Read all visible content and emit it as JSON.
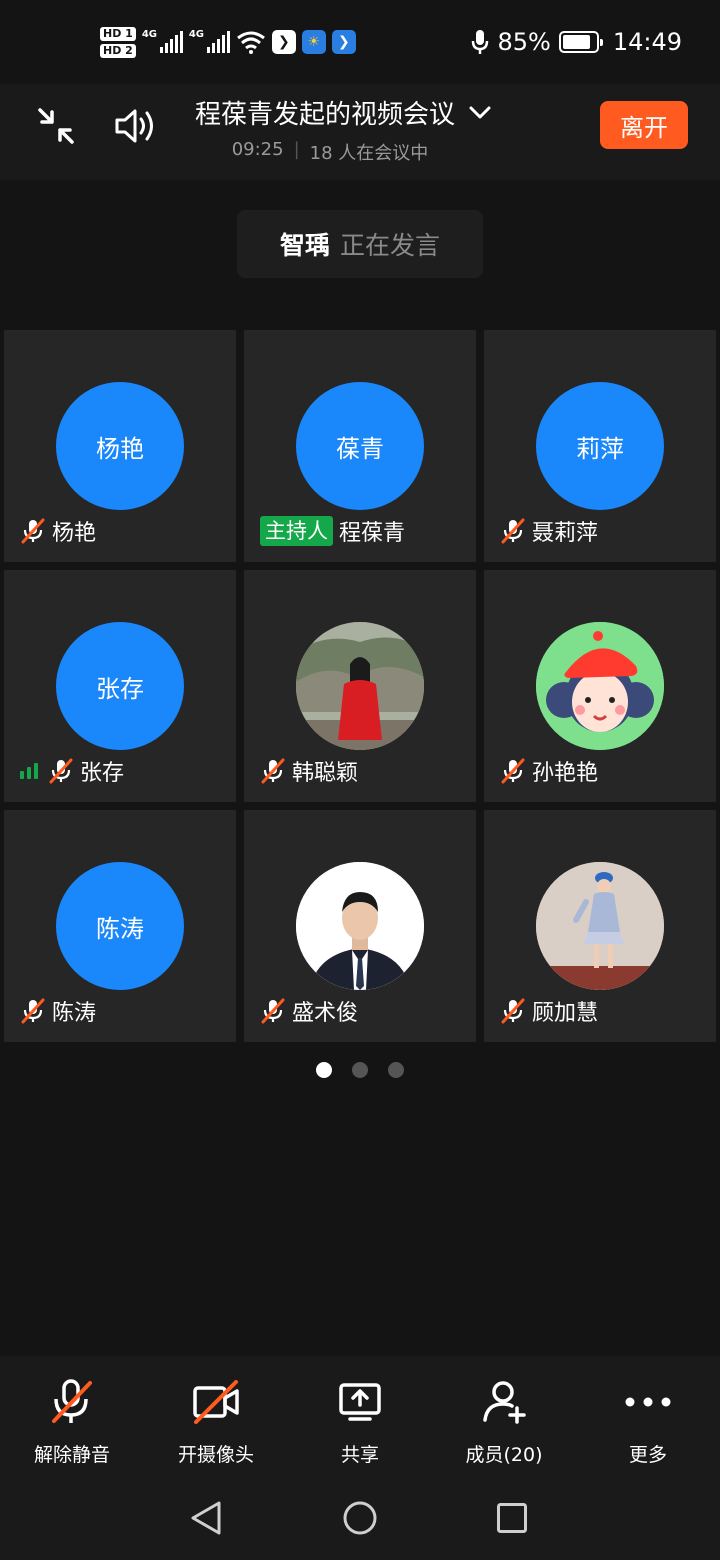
{
  "status_bar": {
    "hd_labels": [
      "HD 1",
      "HD 2"
    ],
    "network_labels": [
      "4G",
      "4G"
    ],
    "battery_percent": "85%",
    "battery_level": 0.85,
    "time": "14:49"
  },
  "header": {
    "title": "程葆青发起的视频会议",
    "duration": "09:25",
    "participants_text": "18 人在会议中",
    "leave_label": "离开"
  },
  "speaking": {
    "name": "智瑀",
    "status": "正在发言"
  },
  "participants": [
    {
      "avatar_text": "杨艳",
      "name": "杨艳",
      "muted": true
    },
    {
      "avatar_text": "葆青",
      "name": "程葆青",
      "host_badge": "主持人",
      "muted": false
    },
    {
      "avatar_text": "莉萍",
      "name": "聂莉萍",
      "muted": true
    },
    {
      "avatar_text": "张存",
      "name": "张存",
      "muted": true,
      "speaking_indicator": true
    },
    {
      "avatar_text": "",
      "name": "韩聪颖",
      "muted": true,
      "photo": "woman-red-coat"
    },
    {
      "avatar_text": "",
      "name": "孙艳艳",
      "muted": true,
      "photo": "cartoon-girl-red-beret"
    },
    {
      "avatar_text": "陈涛",
      "name": "陈涛",
      "muted": true
    },
    {
      "avatar_text": "",
      "name": "盛术俊",
      "muted": true,
      "photo": "man-in-suit"
    },
    {
      "avatar_text": "",
      "name": "顾加慧",
      "muted": true,
      "photo": "girl-blue-outfit"
    }
  ],
  "pagination": {
    "total": 3,
    "current": 1
  },
  "toolbar": {
    "unmute": "解除静音",
    "camera": "开摄像头",
    "share": "共享",
    "members": "成员(20)",
    "more": "更多"
  },
  "colors": {
    "accent_blue": "#1a87fa",
    "leave_orange": "#ff5a1f",
    "host_green": "#15a84a",
    "mute_red": "#ff5a1f"
  }
}
